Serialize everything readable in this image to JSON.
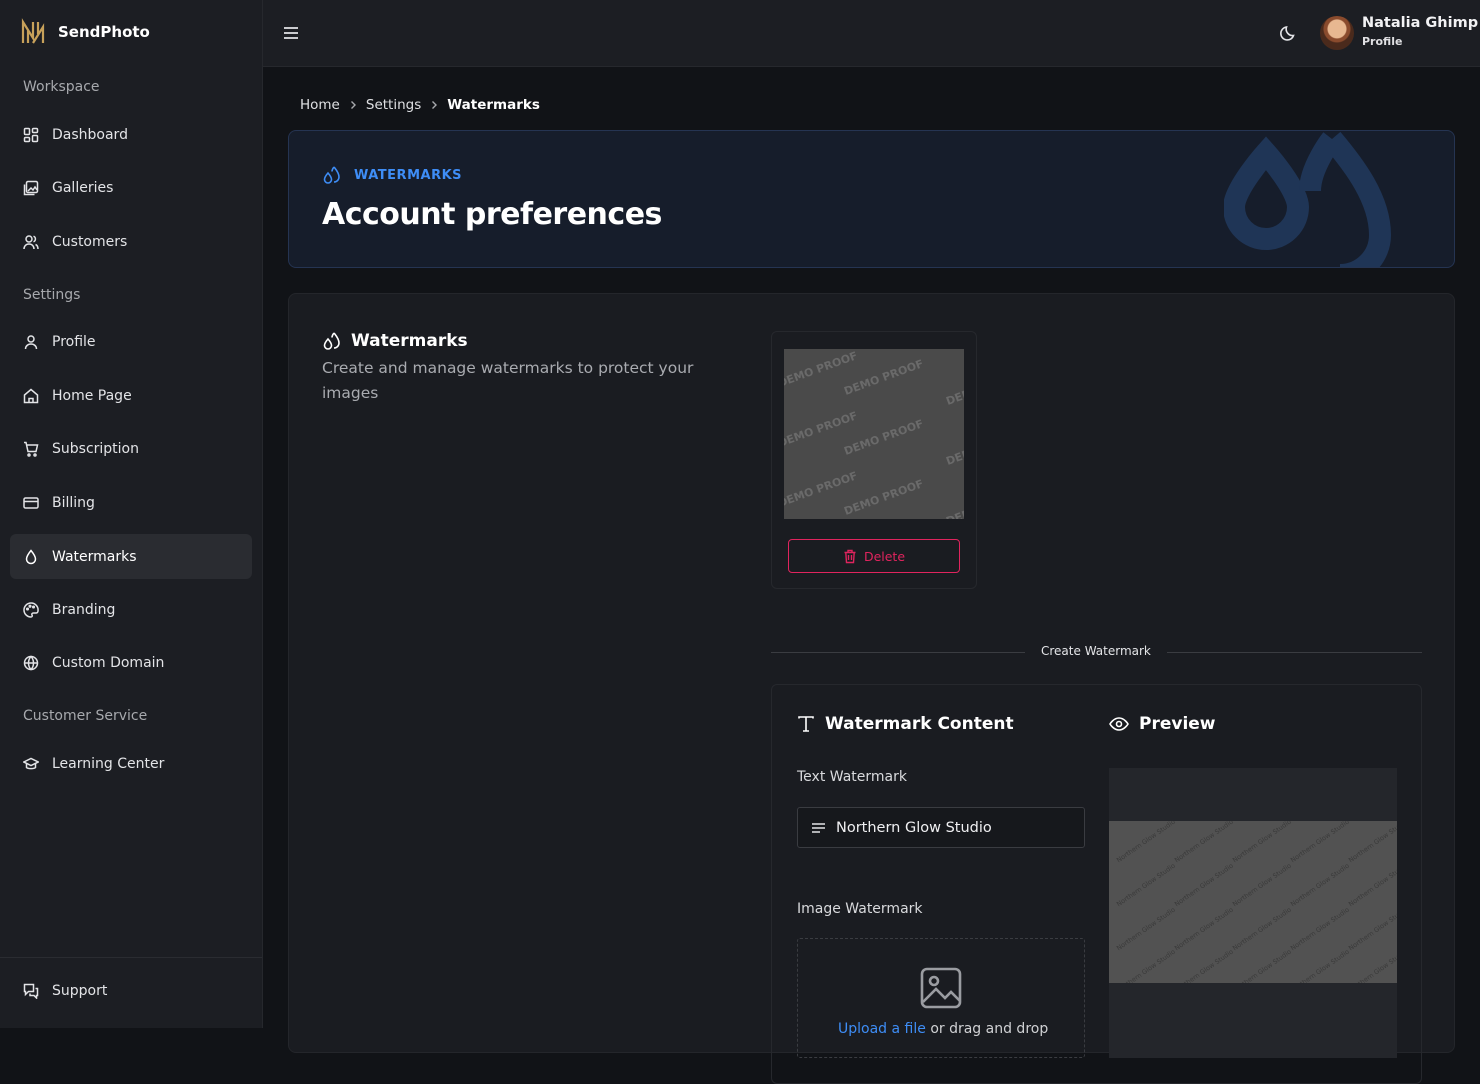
{
  "app": {
    "name": "SendPhoto"
  },
  "sidebar": {
    "sections": [
      {
        "label": "Workspace"
      },
      {
        "label": "Settings"
      },
      {
        "label": "Customer Service"
      }
    ],
    "items": [
      {
        "label": "Dashboard",
        "icon": "grid-icon"
      },
      {
        "label": "Galleries",
        "icon": "gallery-icon"
      },
      {
        "label": "Customers",
        "icon": "users-icon"
      },
      {
        "label": "Profile",
        "icon": "user-icon"
      },
      {
        "label": "Home Page",
        "icon": "home-icon"
      },
      {
        "label": "Subscription",
        "icon": "cart-icon"
      },
      {
        "label": "Billing",
        "icon": "credit-card-icon"
      },
      {
        "label": "Watermarks",
        "icon": "droplet-icon",
        "active": true
      },
      {
        "label": "Branding",
        "icon": "palette-icon"
      },
      {
        "label": "Custom Domain",
        "icon": "globe-icon"
      },
      {
        "label": "Learning Center",
        "icon": "graduation-cap-icon"
      }
    ],
    "support": {
      "label": "Support"
    }
  },
  "topbar": {
    "user": {
      "name": "Natalia Ghimp",
      "role": "Profile"
    }
  },
  "breadcrumb": [
    "Home",
    "Settings",
    "Watermarks"
  ],
  "hero": {
    "tag": "WATERMARKS",
    "title": "Account preferences"
  },
  "watermarks": {
    "title": "Watermarks",
    "description": "Create and manage watermarks to protect your images",
    "existing": {
      "watermark_text": "DEMO PROOF",
      "delete_label": "Delete"
    },
    "divider_label": "Create Watermark",
    "create": {
      "content_title": "Watermark Content",
      "preview_title": "Preview",
      "text_label": "Text Watermark",
      "text_value": "Northern Glow Studio",
      "image_label": "Image Watermark",
      "upload_link": "Upload a file",
      "upload_rest": "or drag and drop"
    }
  },
  "colors": {
    "accent": "#3e8df6",
    "danger": "#e0245e",
    "background": "#111317",
    "panel": "#1c1e23"
  }
}
